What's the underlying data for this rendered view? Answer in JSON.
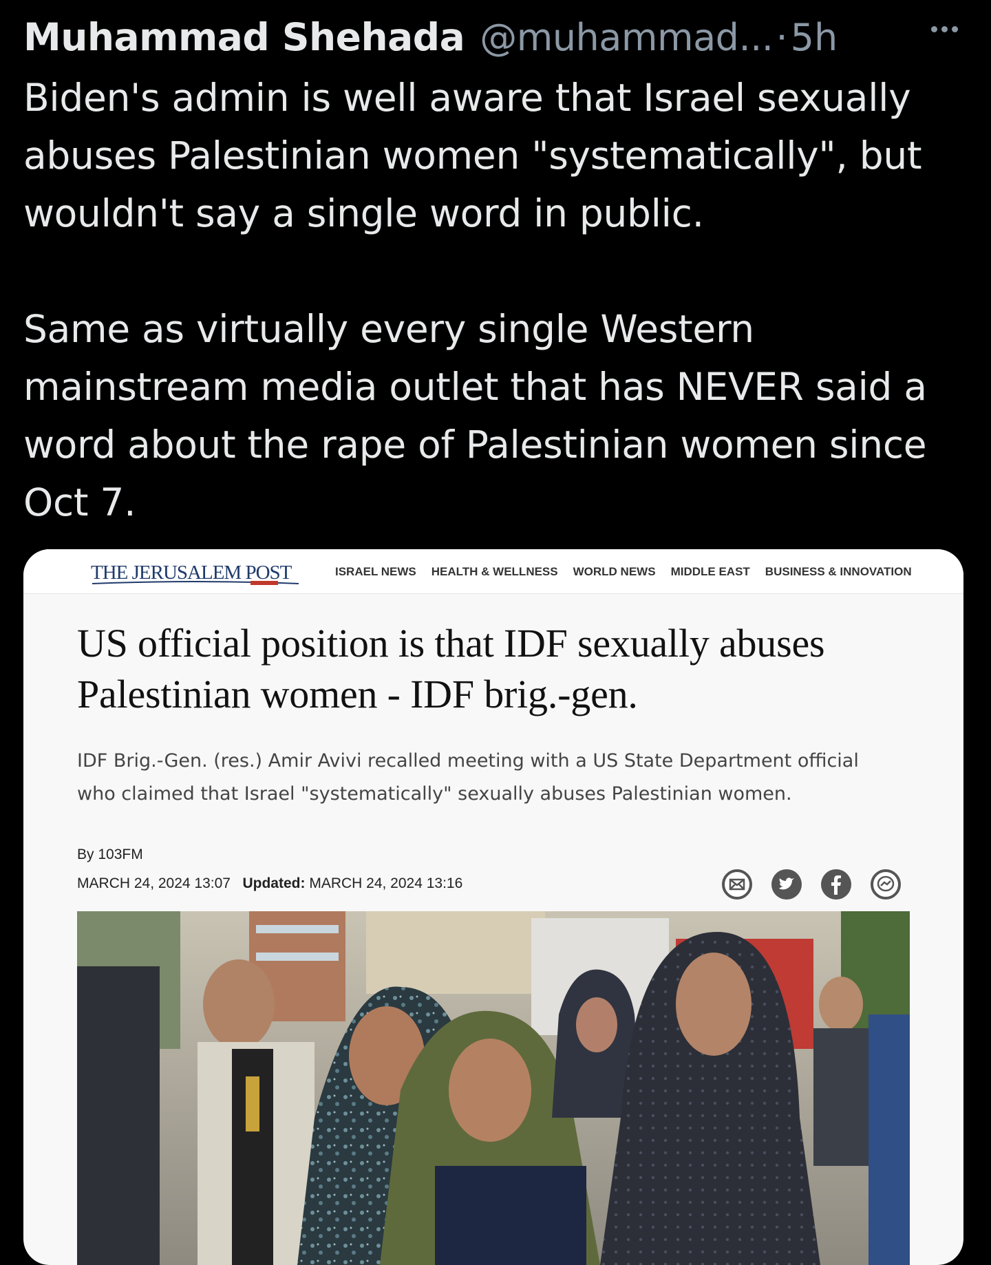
{
  "tweet": {
    "display_name": "Muhammad Shehada",
    "handle": "@muhammad...",
    "separator": "·",
    "time": "5h",
    "paragraphs": [
      "Biden's admin is well aware that Israel sexually abuses Palestinian women \"systematically\", but wouldn't say a single word in public.",
      "Same as virtually every single Western mainstream media outlet that has NEVER said a word about the rape of Palestinian women since Oct 7."
    ]
  },
  "article": {
    "site_logo": "THE JERUSALEM POST",
    "nav": [
      "ISRAEL NEWS",
      "HEALTH & WELLNESS",
      "WORLD NEWS",
      "MIDDLE EAST",
      "BUSINESS & INNOVATION"
    ],
    "headline": "US official position is that IDF sexually abuses Palestinian women - IDF brig.-gen.",
    "subhead": "IDF Brig.-Gen. (res.) Amir Avivi recalled meeting with a US State Department official who claimed that Israel \"systematically\" sexually abuses Palestinian women.",
    "byline": "By 103FM",
    "published": "MARCH 24, 2024 13:07",
    "updated_label": "Updated:",
    "updated": "MARCH 24, 2024 13:16",
    "share_icons": [
      "email-icon",
      "twitter-icon",
      "facebook-icon",
      "messenger-icon"
    ]
  },
  "colors": {
    "background": "#000000",
    "tweet_text": "#e7e9ea",
    "secondary_text": "#8b98a5",
    "card_background": "#f8f8f8",
    "logo_blue": "#1f3a6b"
  }
}
